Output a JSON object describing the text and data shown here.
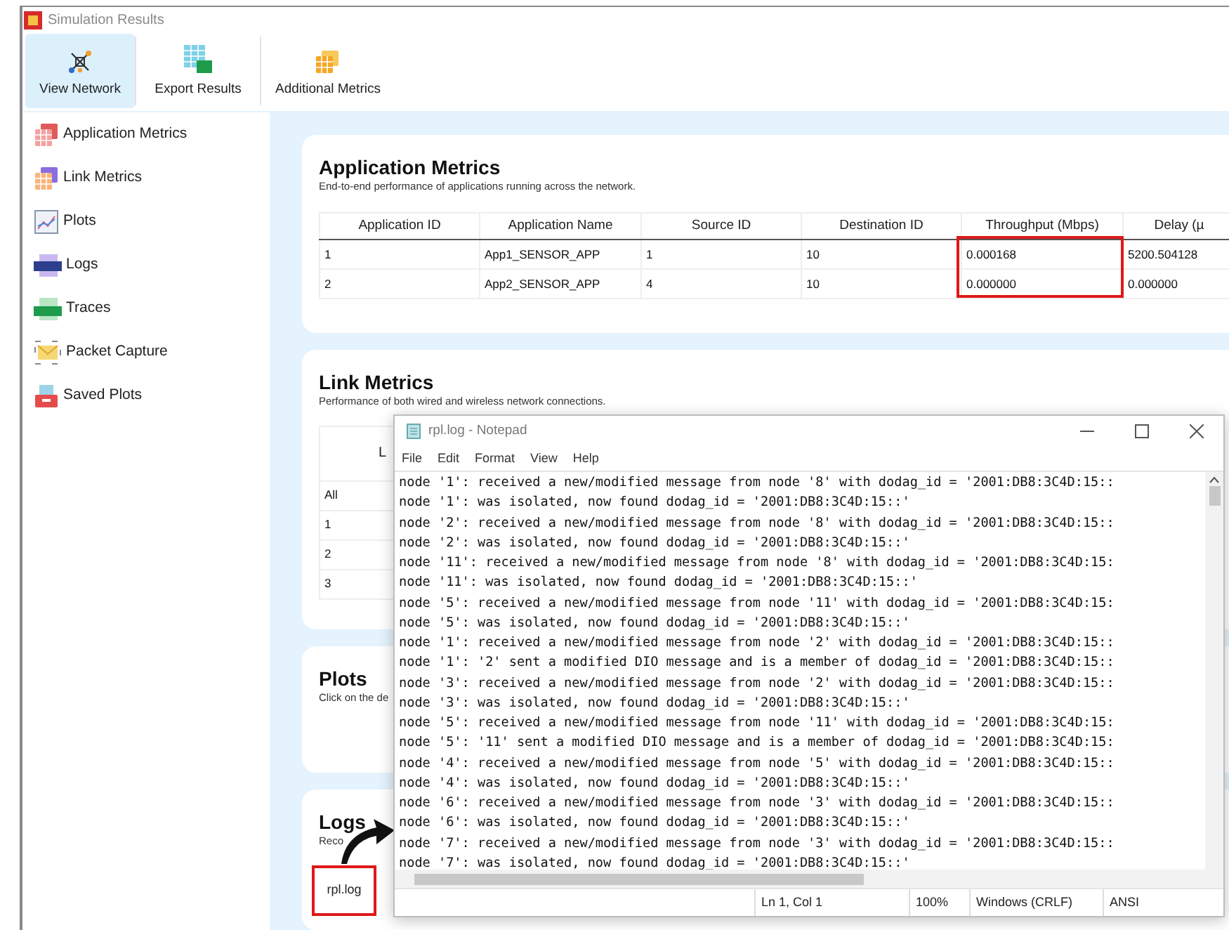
{
  "window": {
    "title": "Simulation Results"
  },
  "toolbar": [
    {
      "label": "View Network",
      "selected": true
    },
    {
      "label": "Export Results",
      "selected": false
    },
    {
      "label": "Additional Metrics",
      "selected": false
    }
  ],
  "sidebar": {
    "items": [
      {
        "label": "Application Metrics"
      },
      {
        "label": "Link Metrics"
      },
      {
        "label": "Plots"
      },
      {
        "label": "Logs"
      },
      {
        "label": "Traces"
      },
      {
        "label": "Packet Capture"
      },
      {
        "label": "Saved Plots"
      }
    ]
  },
  "application_metrics": {
    "title": "Application Metrics",
    "subtitle": "End-to-end performance of applications running across the network.",
    "columns": [
      {
        "label": "Application ID",
        "highlighted": false
      },
      {
        "label": "Application Name",
        "highlighted": false
      },
      {
        "label": "Source ID",
        "highlighted": false
      },
      {
        "label": "Destination ID",
        "highlighted": false
      },
      {
        "label": "Throughput (Mbps)",
        "highlighted": true
      },
      {
        "label": "Delay (µ",
        "highlighted": false
      }
    ],
    "rows": [
      [
        "1",
        "App1_SENSOR_APP",
        "1",
        "10",
        "0.000168",
        "5200.504128"
      ],
      [
        "2",
        "App2_SENSOR_APP",
        "4",
        "10",
        "0.000000",
        "0.000000"
      ]
    ]
  },
  "link_metrics": {
    "title": "Link Metrics",
    "subtitle": "Performance of both wired and wireless network connections.",
    "columns": [
      "L"
    ],
    "rows": [
      "All",
      "1",
      "2",
      "3"
    ]
  },
  "plots": {
    "title": "Plots",
    "subtitle": "Click on the de"
  },
  "logs": {
    "title": "Logs",
    "subtitle": "Reco",
    "files": [
      {
        "name": "rpl.log",
        "highlighted": true
      }
    ]
  },
  "notepad": {
    "title": "rpl.log - Notepad",
    "menu": [
      "File",
      "Edit",
      "Format",
      "View",
      "Help"
    ],
    "lines": [
      "node '1': received a new/modified message from node '8' with dodag_id = '2001:DB8:3C4D:15::",
      "node '1': was isolated, now found dodag_id = '2001:DB8:3C4D:15::'",
      "node '2': received a new/modified message from node '8' with dodag_id = '2001:DB8:3C4D:15::",
      "node '2': was isolated, now found dodag_id = '2001:DB8:3C4D:15::'",
      "node '11': received a new/modified message from node '8' with dodag_id = '2001:DB8:3C4D:15:",
      "node '11': was isolated, now found dodag_id = '2001:DB8:3C4D:15::'",
      "node '5': received a new/modified message from node '11' with dodag_id = '2001:DB8:3C4D:15:",
      "node '5': was isolated, now found dodag_id = '2001:DB8:3C4D:15::'",
      "node '1': received a new/modified message from node '2' with dodag_id = '2001:DB8:3C4D:15::",
      "node '1': '2' sent a modified DIO message and is a member of dodag_id = '2001:DB8:3C4D:15::",
      "node '3': received a new/modified message from node '2' with dodag_id = '2001:DB8:3C4D:15::",
      "node '3': was isolated, now found dodag_id = '2001:DB8:3C4D:15::'",
      "node '5': received a new/modified message from node '11' with dodag_id = '2001:DB8:3C4D:15:",
      "node '5': '11' sent a modified DIO message and is a member of dodag_id = '2001:DB8:3C4D:15:",
      "node '4': received a new/modified message from node '5' with dodag_id = '2001:DB8:3C4D:15::",
      "node '4': was isolated, now found dodag_id = '2001:DB8:3C4D:15::'",
      "node '6': received a new/modified message from node '3' with dodag_id = '2001:DB8:3C4D:15::",
      "node '6': was isolated, now found dodag_id = '2001:DB8:3C4D:15::'",
      "node '7': received a new/modified message from node '3' with dodag_id = '2001:DB8:3C4D:15::",
      "node '7': was isolated, now found dodag_id = '2001:DB8:3C4D:15::'"
    ],
    "status": [
      "Ln 1, Col 1",
      "100%",
      "Windows (CRLF)",
      "ANSI"
    ]
  }
}
